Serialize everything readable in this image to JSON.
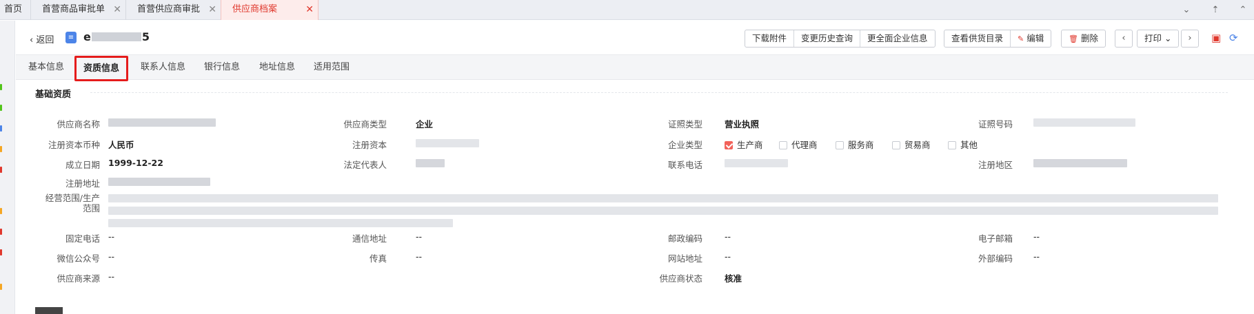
{
  "window_tabs": [
    {
      "label": "首页",
      "closable": false,
      "active": false
    },
    {
      "label": "首营商品审批单",
      "closable": true,
      "active": false
    },
    {
      "label": "首营供应商审批",
      "closable": true,
      "active": false
    },
    {
      "label": "供应商档案",
      "closable": true,
      "active": true
    }
  ],
  "header": {
    "back_label": "返回",
    "title_visible": "e",
    "title_suffix": "5",
    "buttons": {
      "download_attachment": "下载附件",
      "change_history": "变更历史查询",
      "more_company_info": "更全面企业信息",
      "view_catalog": "查看供货目录",
      "edit": "编辑",
      "delete": "删除",
      "print": "打印"
    }
  },
  "subtabs": [
    "基本信息",
    "资质信息",
    "联系人信息",
    "银行信息",
    "地址信息",
    "适用范围"
  ],
  "active_subtab": "资质信息",
  "section": {
    "title": "基础资质"
  },
  "fields": {
    "supplier_name": {
      "label": "供应商名称",
      "value": "",
      "masked": true
    },
    "supplier_type": {
      "label": "供应商类型",
      "value": "企业"
    },
    "license_type": {
      "label": "证照类型",
      "value": "营业执照"
    },
    "license_number": {
      "label": "证照号码",
      "value": "",
      "masked": true
    },
    "capital_currency": {
      "label": "注册资本币种",
      "value": "人民币"
    },
    "registered_capital": {
      "label": "注册资本",
      "value": "",
      "masked": true
    },
    "enterprise_type": {
      "label": "企业类型",
      "options": [
        {
          "label": "生产商",
          "checked": true
        },
        {
          "label": "代理商",
          "checked": false
        },
        {
          "label": "服务商",
          "checked": false
        },
        {
          "label": "贸易商",
          "checked": false
        },
        {
          "label": "其他",
          "checked": false
        }
      ]
    },
    "established_date": {
      "label": "成立日期",
      "value": "1999-12-22"
    },
    "legal_representative": {
      "label": "法定代表人",
      "value": "",
      "masked": true
    },
    "contact_phone": {
      "label": "联系电话",
      "value": "",
      "masked": true
    },
    "registered_region": {
      "label": "注册地区",
      "value": "",
      "masked": true
    },
    "registered_address": {
      "label": "注册地址",
      "value": "",
      "masked": true
    },
    "business_scope": {
      "label_line1": "经营范围/生产",
      "label_line2": "范围",
      "value": "",
      "masked": true
    },
    "fixed_phone": {
      "label": "固定电话",
      "value": "--"
    },
    "mailing_address": {
      "label": "通信地址",
      "value": "--"
    },
    "postal_code": {
      "label": "邮政编码",
      "value": "--"
    },
    "email": {
      "label": "电子邮箱",
      "value": "--"
    },
    "wechat": {
      "label": "微信公众号",
      "value": "--"
    },
    "fax": {
      "label": "传真",
      "value": "--"
    },
    "website": {
      "label": "网站地址",
      "value": "--"
    },
    "external_code": {
      "label": "外部编码",
      "value": "--"
    },
    "supplier_source": {
      "label": "供应商来源",
      "value": "--"
    },
    "supplier_status": {
      "label": "供应商状态",
      "value": "核准"
    }
  },
  "colors": {
    "active_tab_text": "#e0382d",
    "highlight_box": "#e51c1c",
    "checkbox_checked": "#f2625a",
    "doc_icon": "#4c84e8"
  }
}
